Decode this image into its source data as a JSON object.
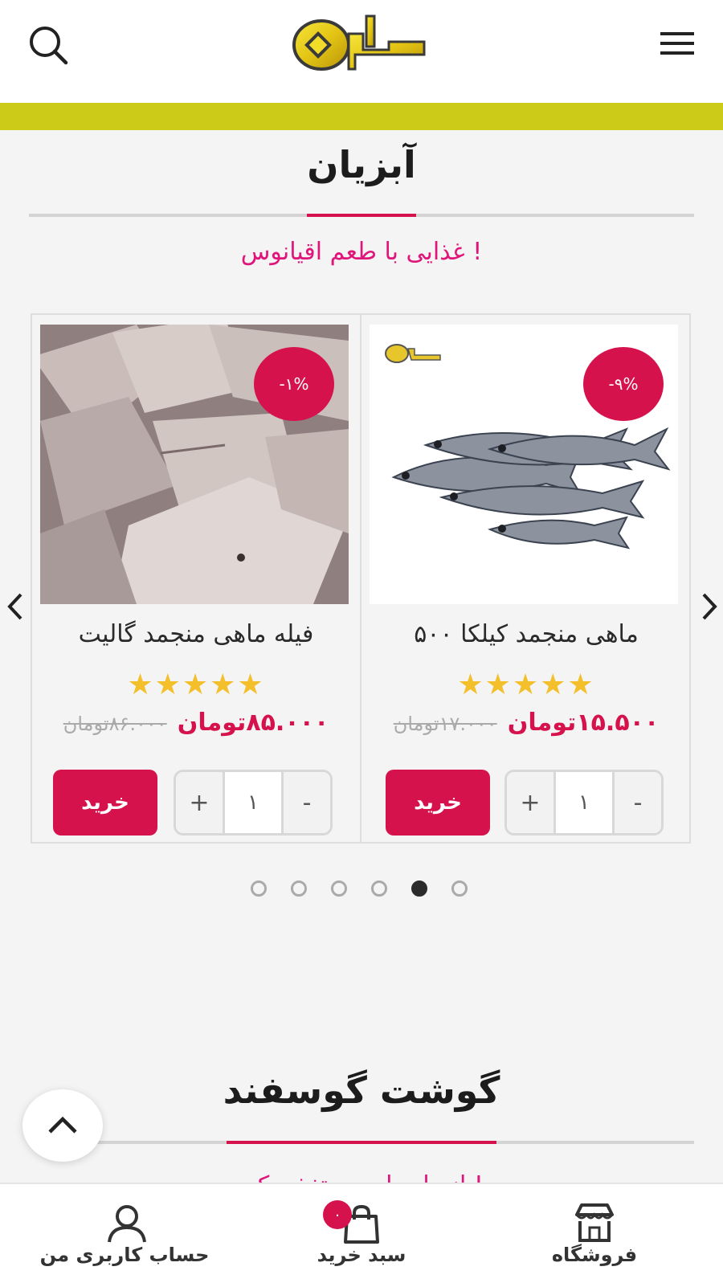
{
  "header": {
    "search_icon": "search-icon",
    "menu_icon": "hamburger-menu-icon",
    "accent_color": "#cbcb18"
  },
  "sections": [
    {
      "title": "آبزیان",
      "subtitle": "غذایی با طعم اقیانوس !"
    },
    {
      "title": "گوشت گوسفند",
      "subtitle": "از دل طبیعت تغذیه کن !"
    }
  ],
  "products": [
    {
      "name": "فیله ماهی منجمد گالیت",
      "discount": "-۱%",
      "rating": 5,
      "price": "۸۵.۰۰۰تومان",
      "old_price": "۸۶.۰۰۰تومان",
      "quantity": "۱",
      "buy_label": "خرید",
      "image": "frozen-fish-fillet-photo"
    },
    {
      "name": "ماهی منجمد کیلکا ۵۰۰",
      "discount": "-۹%",
      "rating": 5,
      "price": "۱۵.۵۰۰تومان",
      "old_price": "۱۷.۰۰۰تومان",
      "quantity": "۱",
      "buy_label": "خرید",
      "image": "kilka-fish-photo"
    }
  ],
  "qty_controls": {
    "minus": "-",
    "plus": "+"
  },
  "stars_text": "★★★★★",
  "carousel": {
    "dot_count": 6,
    "active_dot": 5
  },
  "bottom_nav": {
    "account_label": "حساب کاربری من",
    "cart_label": "سبد خرید",
    "cart_count": "۰",
    "shop_label": "فروشگاه"
  },
  "colors": {
    "brand": "#d6124d",
    "subtitle": "#e0157a",
    "stars": "#f3c02b"
  }
}
